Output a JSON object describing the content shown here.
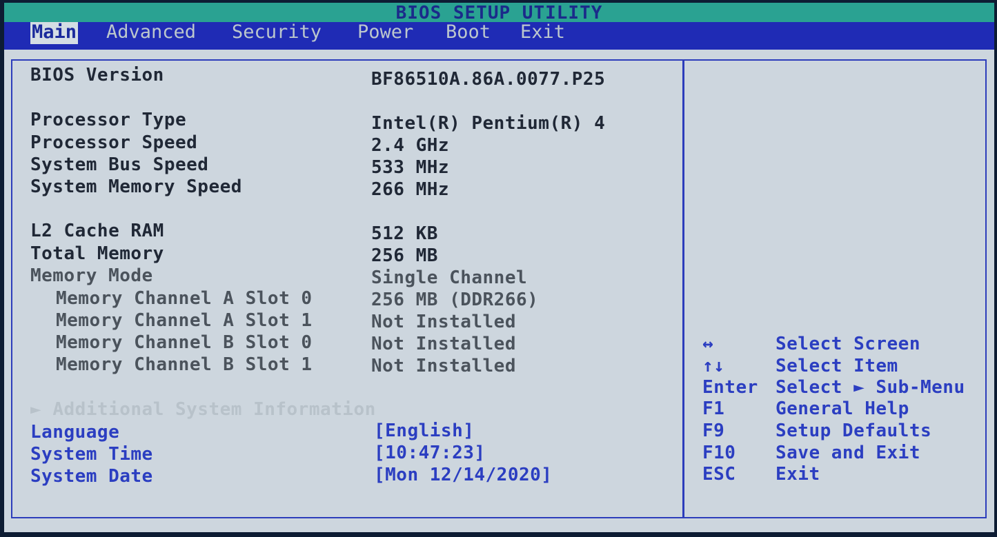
{
  "title": "BIOS SETUP UTILITY",
  "menu": {
    "tabs": [
      {
        "label": "Main"
      },
      {
        "label": "Advanced"
      },
      {
        "label": "Security"
      },
      {
        "label": "Power"
      },
      {
        "label": "Boot"
      },
      {
        "label": "Exit"
      }
    ],
    "active": "Main"
  },
  "info": {
    "bios_version": {
      "label": "BIOS Version",
      "value": "BF86510A.86A.0077.P25"
    },
    "processor_type": {
      "label": "Processor Type",
      "value": "Intel(R) Pentium(R) 4"
    },
    "processor_speed": {
      "label": "Processor Speed",
      "value": "2.4 GHz"
    },
    "system_bus_speed": {
      "label": "System Bus Speed",
      "value": "533 MHz"
    },
    "system_memory_speed": {
      "label": "System Memory Speed",
      "value": "266 MHz"
    },
    "l2_cache": {
      "label": "L2 Cache RAM",
      "value": "512 KB"
    },
    "total_memory": {
      "label": "Total Memory",
      "value": "256 MB"
    },
    "memory_mode": {
      "label": "Memory Mode",
      "value": "Single Channel"
    },
    "slots": [
      {
        "label": "Memory Channel A Slot 0",
        "value": "256 MB (DDR266)"
      },
      {
        "label": "Memory Channel A Slot 1",
        "value": "Not Installed"
      },
      {
        "label": "Memory Channel B Slot 0",
        "value": "Not Installed"
      },
      {
        "label": "Memory Channel B Slot 1",
        "value": "Not Installed"
      }
    ]
  },
  "submenu": {
    "label": "Additional System Information"
  },
  "settings": {
    "language": {
      "label": "Language",
      "value": "[English]"
    },
    "system_time": {
      "label": "System Time",
      "value": "[10:47:23]"
    },
    "system_date": {
      "label": "System Date",
      "value": "[Mon 12/14/2020]"
    }
  },
  "help": [
    {
      "key": "↔",
      "desc": "Select Screen"
    },
    {
      "key": "↑↓",
      "desc": "Select Item"
    },
    {
      "key": "Enter",
      "desc": "Select ► Sub-Menu"
    },
    {
      "key": "F1",
      "desc": "General Help"
    },
    {
      "key": "F9",
      "desc": "Setup Defaults"
    },
    {
      "key": "F10",
      "desc": "Save and Exit"
    },
    {
      "key": "ESC",
      "desc": "Exit"
    }
  ],
  "colors": {
    "title_bar": "#2aa292",
    "menu_bar": "#1f2bb5",
    "panel": "#cdd6de",
    "accent_text": "#2b3ec1",
    "border": "#2c3dbb"
  }
}
